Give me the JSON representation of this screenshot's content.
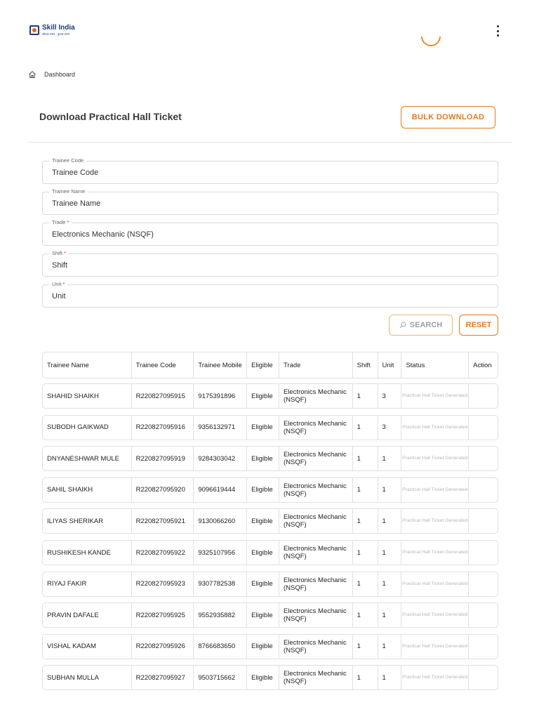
{
  "header": {
    "logo_title": "Skill India",
    "logo_subtitle": "कौशल भारत - कुशल भारत",
    "menu_icon": "kebab-menu-icon",
    "accent_color": "#e27a20"
  },
  "breadcrumb": {
    "home_icon": "home-icon",
    "current": "Dashboard"
  },
  "page": {
    "title": "Download Practical Hall Ticket",
    "bulk_download_label": "BULK DOWNLOAD"
  },
  "form": {
    "trainee_code": {
      "label": "Trainee Code",
      "value": "Trainee Code"
    },
    "trainee_name": {
      "label": "Trainee Name",
      "value": "Trainee Name"
    },
    "trade": {
      "label": "Trade",
      "required": "*",
      "value": "Electronics Mechanic (NSQF)"
    },
    "shift": {
      "label": "Shift",
      "required": "*",
      "value": "Shift"
    },
    "unit": {
      "label": "Unit",
      "required": "*",
      "value": "Unit"
    },
    "search_label": "SEARCH",
    "reset_label": "RESET"
  },
  "table": {
    "headers": [
      "Trainee Name",
      "Trainee Code",
      "Trainee Mobile",
      "Eligible",
      "Trade",
      "Shift",
      "Unit",
      "Status",
      "Action"
    ],
    "rows": [
      {
        "name": "SHAHID SHAIKH",
        "code": "R220827095915",
        "mobile": "9175391896",
        "eligible": "Eligible",
        "trade": "Electronics Mechanic (NSQF)",
        "shift": "1",
        "unit": "3",
        "status": "Practical Hall Ticket Generated",
        "action": ""
      },
      {
        "name": "SUBODH GAIKWAD",
        "code": "R220827095916",
        "mobile": "9356132971",
        "eligible": "Eligible",
        "trade": "Electronics Mechanic (NSQF)",
        "shift": "1",
        "unit": "3",
        "status": "Practical Hall Ticket Generated",
        "action": ""
      },
      {
        "name": "DNYANESHWAR MULE",
        "code": "R220827095919",
        "mobile": "9284303042",
        "eligible": "Eligible",
        "trade": "Electronics Mechanic (NSQF)",
        "shift": "1",
        "unit": "1",
        "status": "Practical Hall Ticket Generated",
        "action": ""
      },
      {
        "name": "SAHIL SHAIKH",
        "code": "R220827095920",
        "mobile": "9096619444",
        "eligible": "Eligible",
        "trade": "Electronics Mechanic (NSQF)",
        "shift": "1",
        "unit": "1",
        "status": "Practical Hall Ticket Generated",
        "action": ""
      },
      {
        "name": "ILIYAS SHERIKAR",
        "code": "R220827095921",
        "mobile": "9130066260",
        "eligible": "Eligible",
        "trade": "Electronics Mechanic (NSQF)",
        "shift": "1",
        "unit": "1",
        "status": "Practical Hall Ticket Generated",
        "action": ""
      },
      {
        "name": "RUSHIKESH KANDE",
        "code": "R220827095922",
        "mobile": "9325107956",
        "eligible": "Eligible",
        "trade": "Electronics Mechanic (NSQF)",
        "shift": "1",
        "unit": "1",
        "status": "Practical Hall Ticket Generated",
        "action": ""
      },
      {
        "name": "RIYAJ FAKIR",
        "code": "R220827095923",
        "mobile": "9307782538",
        "eligible": "Eligible",
        "trade": "Electronics Mechanic (NSQF)",
        "shift": "1",
        "unit": "1",
        "status": "Practical Hall Ticket Generated",
        "action": ""
      },
      {
        "name": "PRAVIN DAFALE",
        "code": "R220827095925",
        "mobile": "9552935882",
        "eligible": "Eligible",
        "trade": "Electronics Mechanic (NSQF)",
        "shift": "1",
        "unit": "1",
        "status": "Practical Hall Ticket Generated",
        "action": ""
      },
      {
        "name": "VISHAL KADAM",
        "code": "R220827095926",
        "mobile": "8766683650",
        "eligible": "Eligible",
        "trade": "Electronics Mechanic (NSQF)",
        "shift": "1",
        "unit": "1",
        "status": "Practical Hall Ticket Generated",
        "action": ""
      },
      {
        "name": "SUBHAN MULLA",
        "code": "R220827095927",
        "mobile": "9503715662",
        "eligible": "Eligible",
        "trade": "Electronics Mechanic (NSQF)",
        "shift": "1",
        "unit": "1",
        "status": "Practical Hall Ticket Generated",
        "action": ""
      }
    ]
  }
}
